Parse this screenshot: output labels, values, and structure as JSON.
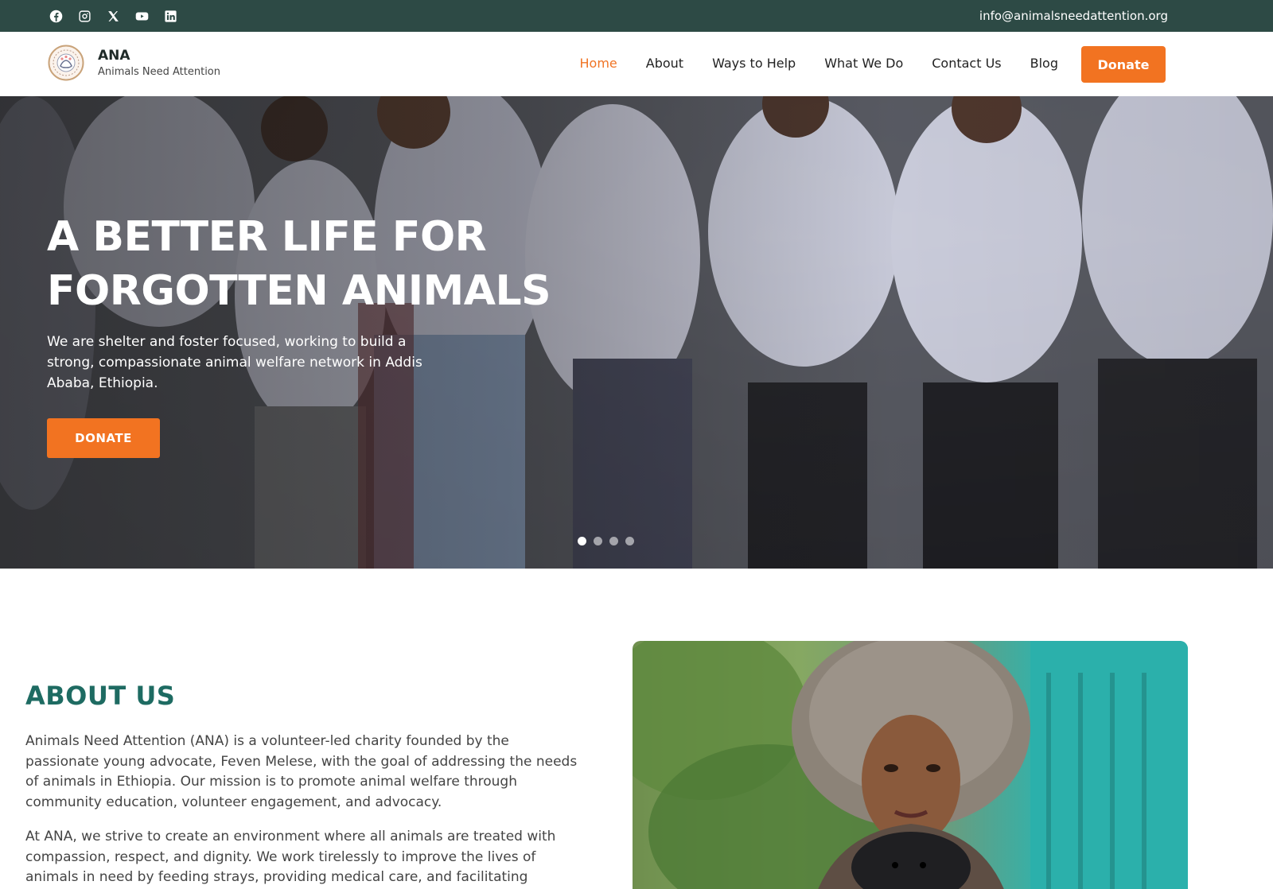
{
  "topbar": {
    "social": [
      "facebook-icon",
      "instagram-icon",
      "x-icon",
      "youtube-icon",
      "linkedin-icon"
    ],
    "email": "info@animalsneedattention.org"
  },
  "header": {
    "brand_name": "ANA",
    "brand_tagline": "Animals Need Attention",
    "nav": [
      {
        "label": "Home",
        "active": true
      },
      {
        "label": "About",
        "active": false
      },
      {
        "label": "Ways to Help",
        "active": false
      },
      {
        "label": "What We Do",
        "active": false
      },
      {
        "label": "Contact Us",
        "active": false
      },
      {
        "label": "Blog",
        "active": false
      }
    ],
    "donate_label": "Donate"
  },
  "hero": {
    "title_line1": "A BETTER LIFE FOR",
    "title_line2": "FORGOTTEN ANIMALS",
    "subtitle": "We are shelter and foster focused, working to build a strong, compassionate animal welfare network in Addis Ababa, Ethiopia.",
    "button_label": "DONATE",
    "slides": 4,
    "active_slide": 1
  },
  "about": {
    "title": "ABOUT US",
    "paragraph1": "Animals Need Attention (ANA) is a volunteer-led charity founded by the passionate young advocate, Feven Melese, with the goal of addressing the needs of animals in Ethiopia. Our mission is to promote animal welfare through community education, volunteer engagement, and advocacy.",
    "paragraph2": "At ANA, we strive to create an environment where all animals are treated with compassion, respect, and dignity. We work tirelessly to improve the lives of animals in need by feeding strays, providing medical care, and facilitating"
  },
  "colors": {
    "topbar": "#2d4a45",
    "accent": "#f27321",
    "heading": "#1e6b62"
  }
}
